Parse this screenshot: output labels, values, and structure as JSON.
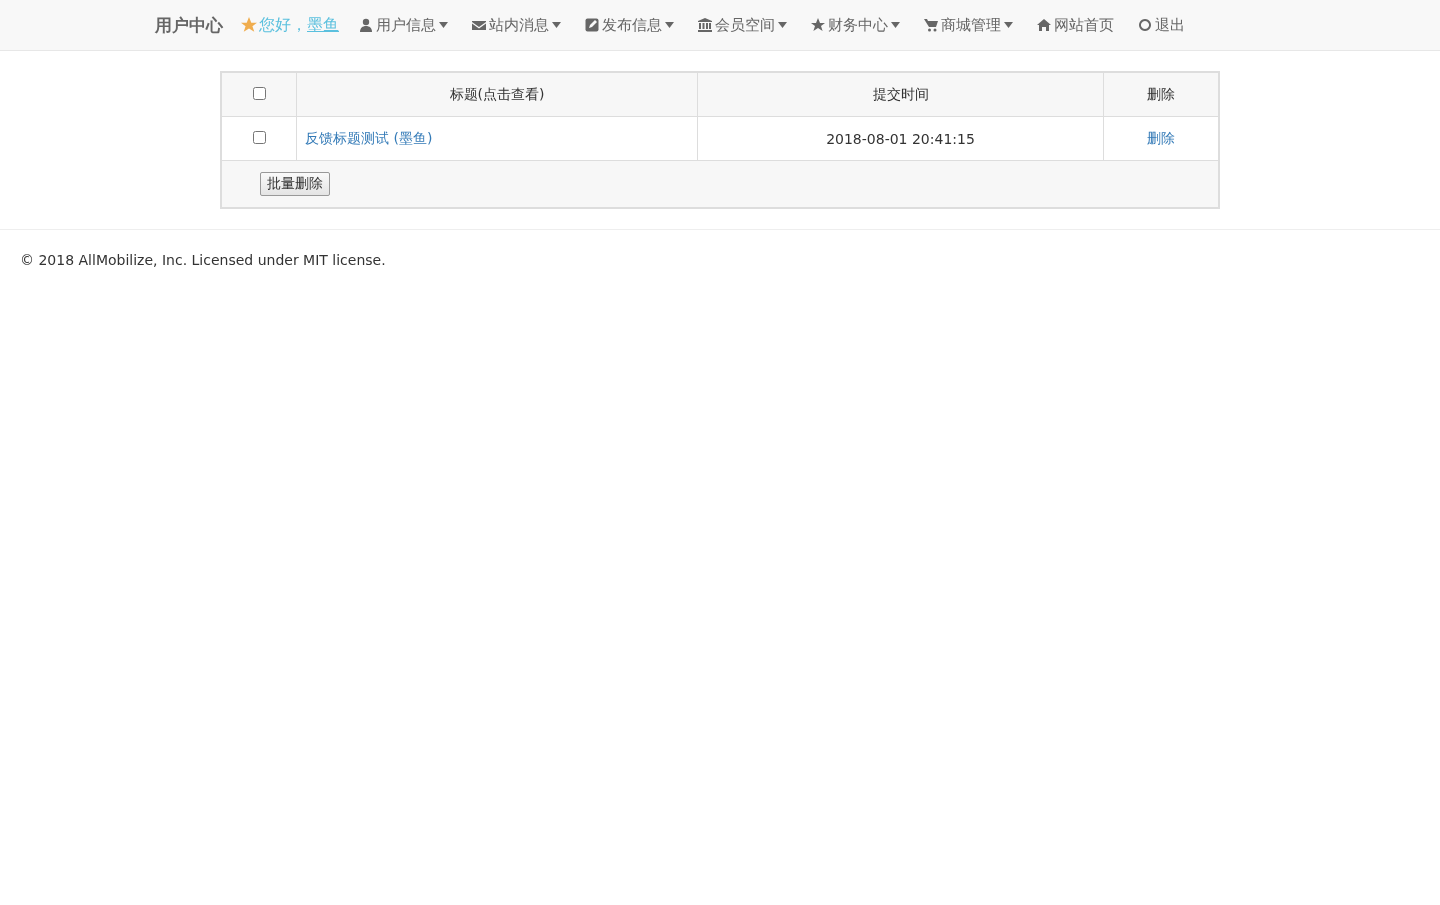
{
  "navbar": {
    "brand": "用户中心",
    "greeting": "您好，",
    "user_name": "墨鱼",
    "items": [
      {
        "label": "用户信息",
        "dropdown": true
      },
      {
        "label": "站内消息",
        "dropdown": true
      },
      {
        "label": "发布信息",
        "dropdown": true
      },
      {
        "label": "会员空间",
        "dropdown": true
      },
      {
        "label": "财务中心",
        "dropdown": true
      },
      {
        "label": "商城管理",
        "dropdown": true
      },
      {
        "label": "网站首页",
        "dropdown": false
      },
      {
        "label": "退出",
        "dropdown": false
      }
    ]
  },
  "table": {
    "select_all_checked": false,
    "columns": [
      "标题(点击查看)",
      "提交时间",
      "删除"
    ],
    "rows": [
      {
        "checked": false,
        "title": "反馈标题测试 (墨鱼)",
        "time": "2018-08-01 20:41:15",
        "action": "删除"
      }
    ],
    "bulk_button": "批量删除"
  },
  "footer": "© 2018 AllMobilize, Inc. Licensed under MIT license."
}
